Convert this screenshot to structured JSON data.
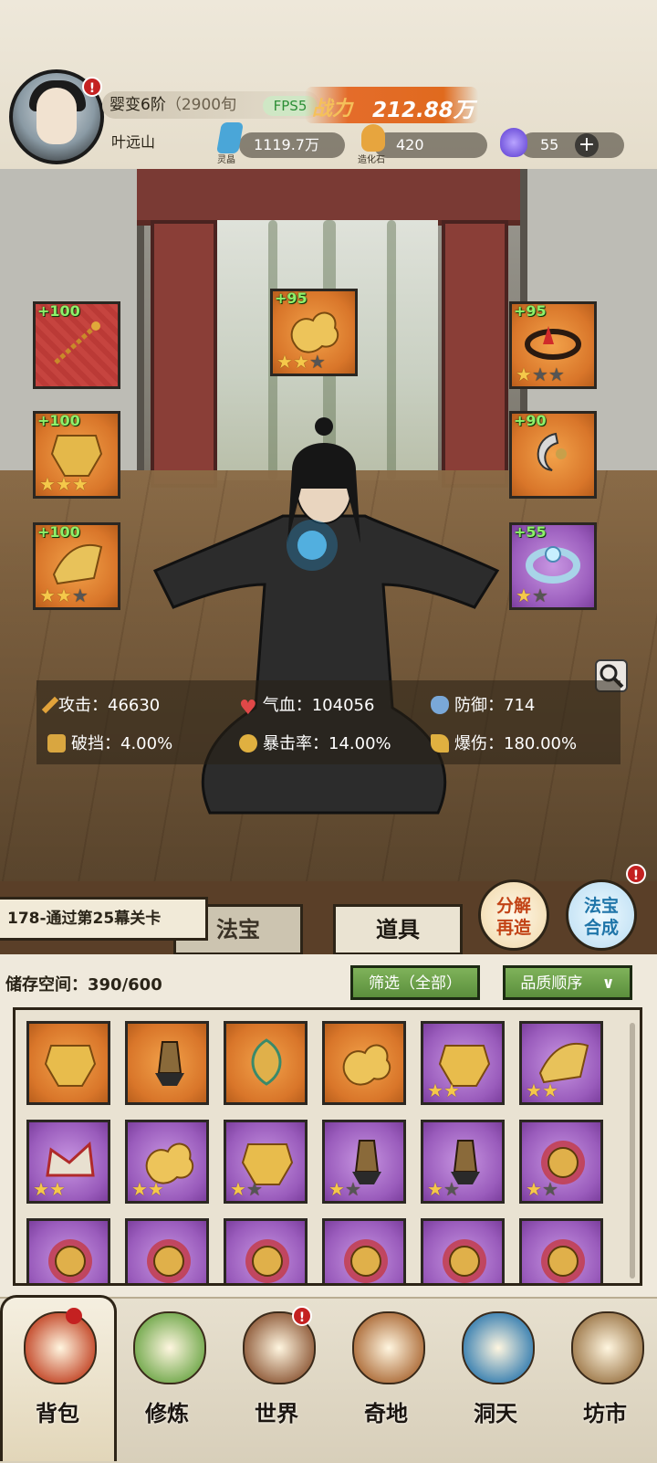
{
  "player": {
    "realm": "婴变6阶",
    "realm_sub": "（2900旬",
    "fps": "FPS5",
    "power_label": "战力",
    "power_value": "212.88万",
    "name": "叶远山",
    "badge": "!"
  },
  "resources": [
    {
      "label": "灵晶",
      "value": "1119.7万",
      "icon": "crystal-icon",
      "color": "#4aa6d8"
    },
    {
      "label": "造化石",
      "value": "420",
      "icon": "stone-icon",
      "color": "#e7a53e"
    },
    {
      "label": "",
      "value": "55",
      "icon": "soul-flame-icon",
      "color": "#6a4ad6"
    }
  ],
  "equipped": {
    "left": [
      {
        "plus": "+100",
        "stars": 0,
        "max": 0,
        "rarity": "red",
        "item": "chain-weapon-icon"
      },
      {
        "plus": "+100",
        "stars": 3,
        "max": 3,
        "rarity": "orange",
        "item": "armor-icon"
      },
      {
        "plus": "+100",
        "stars": 2,
        "max": 3,
        "rarity": "orange",
        "item": "boots-icon"
      }
    ],
    "center": {
      "plus": "+95",
      "stars": 2,
      "max": 3,
      "rarity": "orange",
      "item": "golden-cloud-icon"
    },
    "right": [
      {
        "plus": "+95",
        "stars": 1,
        "max": 3,
        "rarity": "orange",
        "item": "crown-icon"
      },
      {
        "plus": "+90",
        "stars": 0,
        "max": 0,
        "rarity": "orange",
        "item": "pendant-icon"
      },
      {
        "plus": "+55",
        "stars": 1,
        "max": 2,
        "rarity": "purple",
        "item": "bracelet-icon"
      }
    ]
  },
  "stats": [
    {
      "label": "攻击：",
      "value": "46630",
      "icon": "sword-icon"
    },
    {
      "label": "气血：",
      "value": "104056",
      "icon": "heart-icon"
    },
    {
      "label": "防御：",
      "value": "714",
      "icon": "shield-icon"
    },
    {
      "label": "破挡：",
      "value": "4.00%",
      "icon": "break-icon"
    },
    {
      "label": "暴击率：",
      "value": "14.00%",
      "icon": "crit-icon"
    },
    {
      "label": "爆伤：",
      "value": "180.00%",
      "icon": "crit-damage-icon"
    }
  ],
  "quest": "178-通过第25幕关卡",
  "tabs": {
    "fabao": "法宝",
    "daoju": "道具"
  },
  "buttons": {
    "decompose": "分解\n再造",
    "combine": "法宝\n合成"
  },
  "storage": {
    "label": "储存空间：",
    "value": "390/600"
  },
  "filters": {
    "filter": "筛选（全部）",
    "sort": "品质顺序"
  },
  "inventory": [
    {
      "rarity": "orange",
      "stars": 0,
      "max": 0,
      "item": "armor-icon"
    },
    {
      "rarity": "orange",
      "stars": 0,
      "max": 0,
      "item": "staff-icon"
    },
    {
      "rarity": "orange",
      "stars": 0,
      "max": 0,
      "item": "dragon-icon"
    },
    {
      "rarity": "orange",
      "stars": 0,
      "max": 0,
      "item": "golden-cloud-icon"
    },
    {
      "rarity": "purple",
      "stars": 2,
      "max": 2,
      "item": "armor-icon"
    },
    {
      "rarity": "purple",
      "stars": 2,
      "max": 2,
      "item": "boots-icon"
    },
    {
      "rarity": "purple",
      "stars": 2,
      "max": 2,
      "item": "crown-icon"
    },
    {
      "rarity": "purple",
      "stars": 2,
      "max": 2,
      "item": "golden-cloud-icon"
    },
    {
      "rarity": "purple",
      "stars": 1,
      "max": 2,
      "item": "armor-icon"
    },
    {
      "rarity": "purple",
      "stars": 1,
      "max": 2,
      "item": "staff-icon"
    },
    {
      "rarity": "purple",
      "stars": 1,
      "max": 2,
      "item": "staff-icon"
    },
    {
      "rarity": "purple",
      "stars": 1,
      "max": 2,
      "item": "lion-icon"
    },
    {
      "rarity": "purple",
      "stars": 0,
      "max": 0,
      "item": "lion-icon"
    },
    {
      "rarity": "purple",
      "stars": 0,
      "max": 0,
      "item": "lion-icon"
    },
    {
      "rarity": "purple",
      "stars": 0,
      "max": 0,
      "item": "lion-icon"
    },
    {
      "rarity": "purple",
      "stars": 0,
      "max": 0,
      "item": "lion-icon"
    },
    {
      "rarity": "purple",
      "stars": 0,
      "max": 0,
      "item": "lion-icon"
    },
    {
      "rarity": "purple",
      "stars": 0,
      "max": 0,
      "item": "lion-icon"
    }
  ],
  "nav": [
    {
      "label": "背包",
      "icon": "bag-icon",
      "color": "#c9583a",
      "badge": false
    },
    {
      "label": "修炼",
      "icon": "lotus-icon",
      "color": "#7fb05a",
      "badge": false
    },
    {
      "label": "世界",
      "icon": "scroll-icon",
      "color": "#9a6a4a",
      "badge": true
    },
    {
      "label": "奇地",
      "icon": "island-icon",
      "color": "#b57a4a",
      "badge": false
    },
    {
      "label": "洞天",
      "icon": "portal-icon",
      "color": "#4a8ab5",
      "badge": false
    },
    {
      "label": "坊市",
      "icon": "shop-icon",
      "color": "#a8865a",
      "badge": false
    }
  ],
  "colors": {
    "orange": "#d9762a",
    "purple": "#9a5cbc",
    "red": "#c6443f",
    "plus_text": "#8ef06a",
    "badge": "#c42121"
  }
}
